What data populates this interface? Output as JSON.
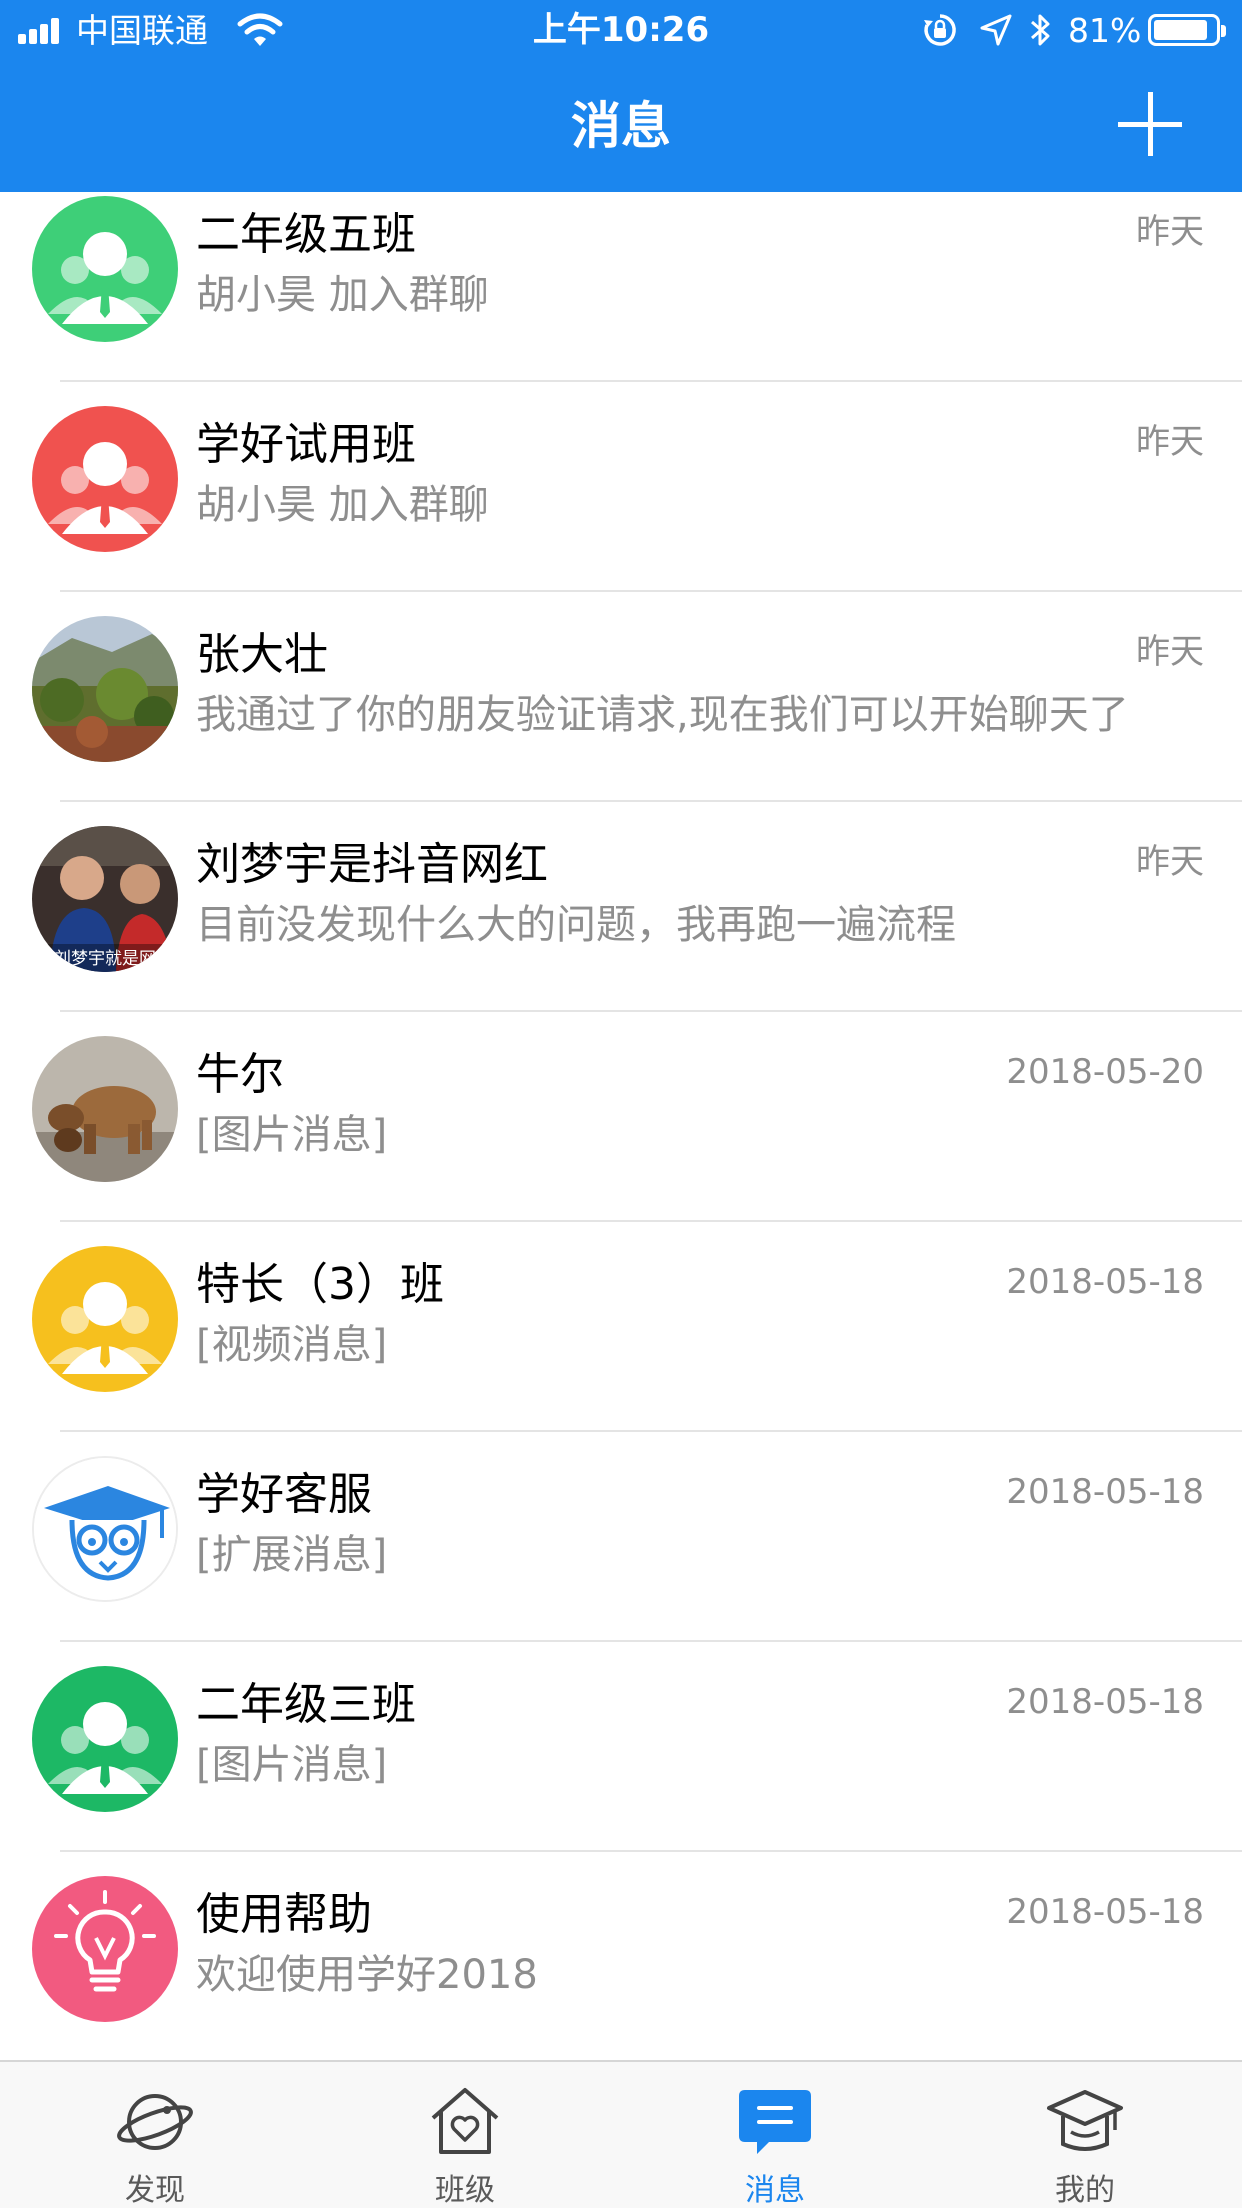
{
  "status_bar": {
    "carrier": "中国联通",
    "time": "上午10:26",
    "battery": "81%",
    "battery_level": 0.81
  },
  "header": {
    "title": "消息",
    "add_icon": "plus-icon"
  },
  "conversations": [
    {
      "name": "二年级五班",
      "preview": "胡小昊 加入群聊",
      "time": "昨天",
      "avatar": "group-avatar",
      "avatar_color": "#3ecf78"
    },
    {
      "name": "学好试用班",
      "preview": "胡小昊 加入群聊",
      "time": "昨天",
      "avatar": "group-avatar",
      "avatar_color": "#f0524f"
    },
    {
      "name": "张大壮",
      "preview": "我通过了你的朋友验证请求,现在我们可以开始聊天了",
      "time": "昨天",
      "avatar": "landscape-photo"
    },
    {
      "name": "刘梦宇是抖音网红",
      "preview": "目前没发现什么大的问题，我再跑一遍流程",
      "time": "昨天",
      "avatar": "people-photo",
      "avatar_caption": "刘梦宇就是网"
    },
    {
      "name": "牛尔",
      "preview": "[图片消息]",
      "time": "2018-05-20",
      "avatar": "bear-photo"
    },
    {
      "name": "特长（3）班",
      "preview": "[视频消息]",
      "time": "2018-05-18",
      "avatar": "group-avatar",
      "avatar_color": "#f6c01e"
    },
    {
      "name": "学好客服",
      "preview": "[扩展消息]",
      "time": "2018-05-18",
      "avatar": "mascot-avatar",
      "avatar_color": "#2b86e0"
    },
    {
      "name": "二年级三班",
      "preview": "[图片消息]",
      "time": "2018-05-18",
      "avatar": "group-avatar",
      "avatar_color": "#1db865"
    },
    {
      "name": "使用帮助",
      "preview": "欢迎使用学好2018",
      "time": "2018-05-18",
      "avatar": "lightbulb-avatar",
      "avatar_color": "#f25a80"
    }
  ],
  "tabbar": {
    "active_color": "#1b86ee",
    "tabs": [
      {
        "label": "发现",
        "icon": "planet-icon"
      },
      {
        "label": "班级",
        "icon": "house-heart-icon"
      },
      {
        "label": "消息",
        "icon": "chat-bubble-icon",
        "active": true
      },
      {
        "label": "我的",
        "icon": "graduation-cap-icon"
      }
    ]
  }
}
